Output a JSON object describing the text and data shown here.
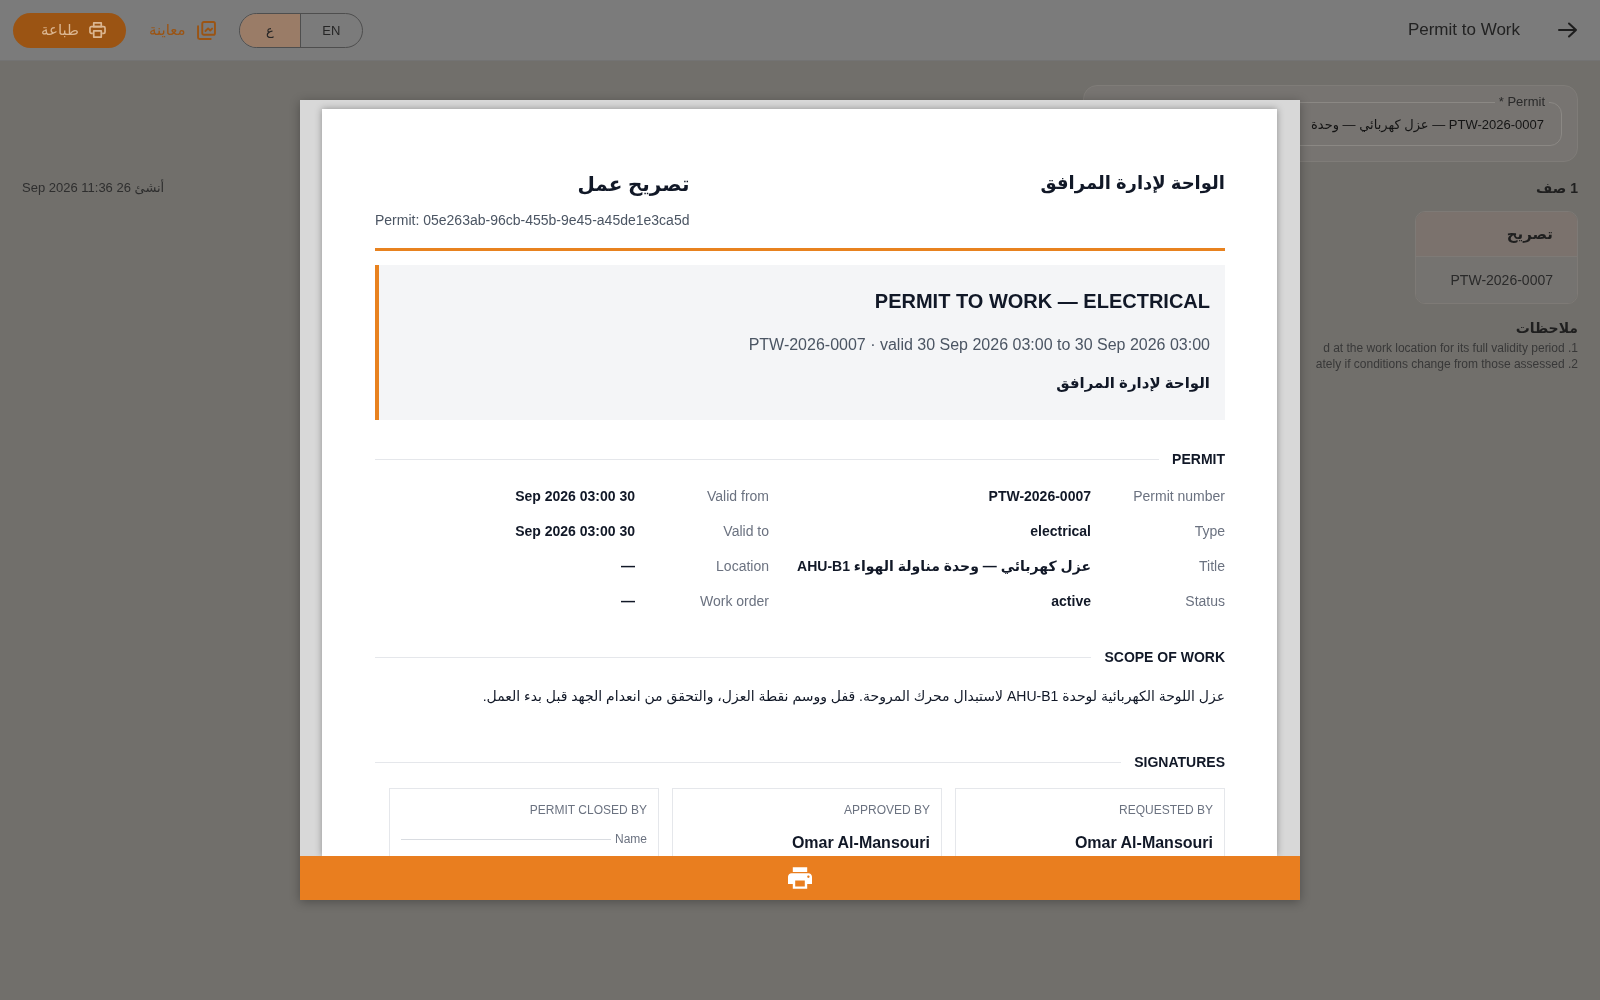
{
  "top_bar": {
    "title": "Permit to Work",
    "language_toggle": [
      {
        "label": "ع",
        "selected": true
      },
      {
        "label": "EN",
        "selected": false
      }
    ],
    "actions": [
      {
        "kind": "preview",
        "label": "معاينة"
      },
      {
        "kind": "print",
        "label": "طباعة"
      }
    ]
  },
  "permit_field": {
    "label": "Permit *",
    "value": "PTW-2026-0007 — عزل كهربائي — وحدة"
  },
  "results": {
    "count": "1 صف",
    "columns": [
      "تصريح"
    ],
    "rows": [
      [
        "PTW-2026-0007"
      ]
    ]
  },
  "notes": {
    "title": "ملاحظات",
    "items": [
      "1. d at the work location for its full validity period",
      "2. ately if conditions change from those assessed"
    ]
  },
  "created": "أنشئ 26 Sep 2026 11:36",
  "preview": {
    "organization": "الواحة لإدارة المرافق",
    "document_title": "تصريح عمل",
    "reference": "Permit: 05e263ab-96cb-455b-9e45-a45de1e3ca5d",
    "banner": {
      "title": "PERMIT TO WORK — ELECTRICAL",
      "subtitle": "PTW-2026-0007 · valid 30 Sep 2026 03:00 to 30 Sep 2026 03:00",
      "organization": "الواحة لإدارة المرافق"
    },
    "sections": [
      {
        "kind": "fields",
        "title": "PERMIT",
        "columns": [
          [
            {
              "label": "Valid from",
              "value": "30 Sep 2026 03:00"
            },
            {
              "label": "Valid to",
              "value": "30 Sep 2026 03:00"
            },
            {
              "label": "Location",
              "value": "—"
            },
            {
              "label": "Work order",
              "value": "—"
            }
          ],
          [
            {
              "label": "Permit number",
              "value": "PTW-2026-0007"
            },
            {
              "label": "Type",
              "value": "electrical"
            },
            {
              "label": "Title",
              "value": "عزل كهربائي — وحدة مناولة الهواء AHU-B1"
            },
            {
              "label": "Status",
              "value": "active"
            }
          ]
        ]
      },
      {
        "kind": "text",
        "title": "SCOPE OF WORK",
        "text": "عزل اللوحة الكهربائية لوحدة AHU-B1 لاستبدال محرك المروحة. قفل ووسم نقطة العزل، والتحقق من انعدام الجهد قبل بدء العمل."
      },
      {
        "kind": "signatures",
        "title": "SIGNATURES",
        "signatures": [
          {
            "kind": "blank",
            "role": "PERMIT CLOSED BY",
            "caption": "Name"
          },
          {
            "kind": "signed",
            "role": "APPROVED BY",
            "name": "Omar Al-Mansouri"
          },
          {
            "kind": "signed",
            "role": "REQUESTED BY",
            "name": "Omar Al-Mansouri"
          }
        ]
      }
    ]
  }
}
